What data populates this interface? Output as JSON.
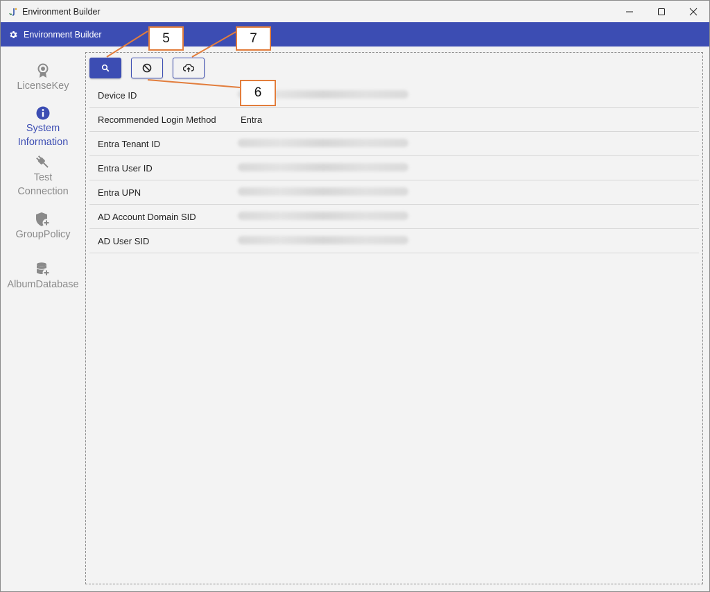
{
  "window": {
    "title": "Environment Builder"
  },
  "appbar": {
    "title": "Environment Builder"
  },
  "sidebar": {
    "items": [
      {
        "label": "LicenseKey",
        "icon": "license-badge-icon",
        "active": false
      },
      {
        "label": "System\nInformation",
        "icon": "info-icon",
        "active": true
      },
      {
        "label": "Test\nConnection",
        "icon": "plug-icon",
        "active": false
      },
      {
        "label": "GroupPolicy",
        "icon": "shield-plus-icon",
        "active": false
      },
      {
        "label": "AlbumDatabase",
        "icon": "database-plus-icon",
        "active": false
      }
    ]
  },
  "toolbar": {
    "buttons": [
      {
        "icon": "search-icon"
      },
      {
        "icon": "cancel-icon"
      },
      {
        "icon": "cloud-upload-icon"
      }
    ]
  },
  "system_info": {
    "rows": [
      {
        "label": "Device ID",
        "value": "",
        "blurred": true
      },
      {
        "label": "Recommended Login Method",
        "value": "Entra",
        "blurred": false
      },
      {
        "label": "Entra Tenant ID",
        "value": "",
        "blurred": true
      },
      {
        "label": "Entra User ID",
        "value": "",
        "blurred": true
      },
      {
        "label": "Entra UPN",
        "value": "",
        "blurred": true
      },
      {
        "label": "AD Account Domain SID",
        "value": "",
        "blurred": true
      },
      {
        "label": "AD User SID",
        "value": "",
        "blurred": true
      }
    ]
  },
  "annotations": {
    "callout_5": "5",
    "callout_6": "6",
    "callout_7": "7",
    "color": "#e27d3c"
  },
  "colors": {
    "accent": "#3c4db3",
    "background": "#f3f3f3",
    "inactive": "#8a8a8a"
  }
}
